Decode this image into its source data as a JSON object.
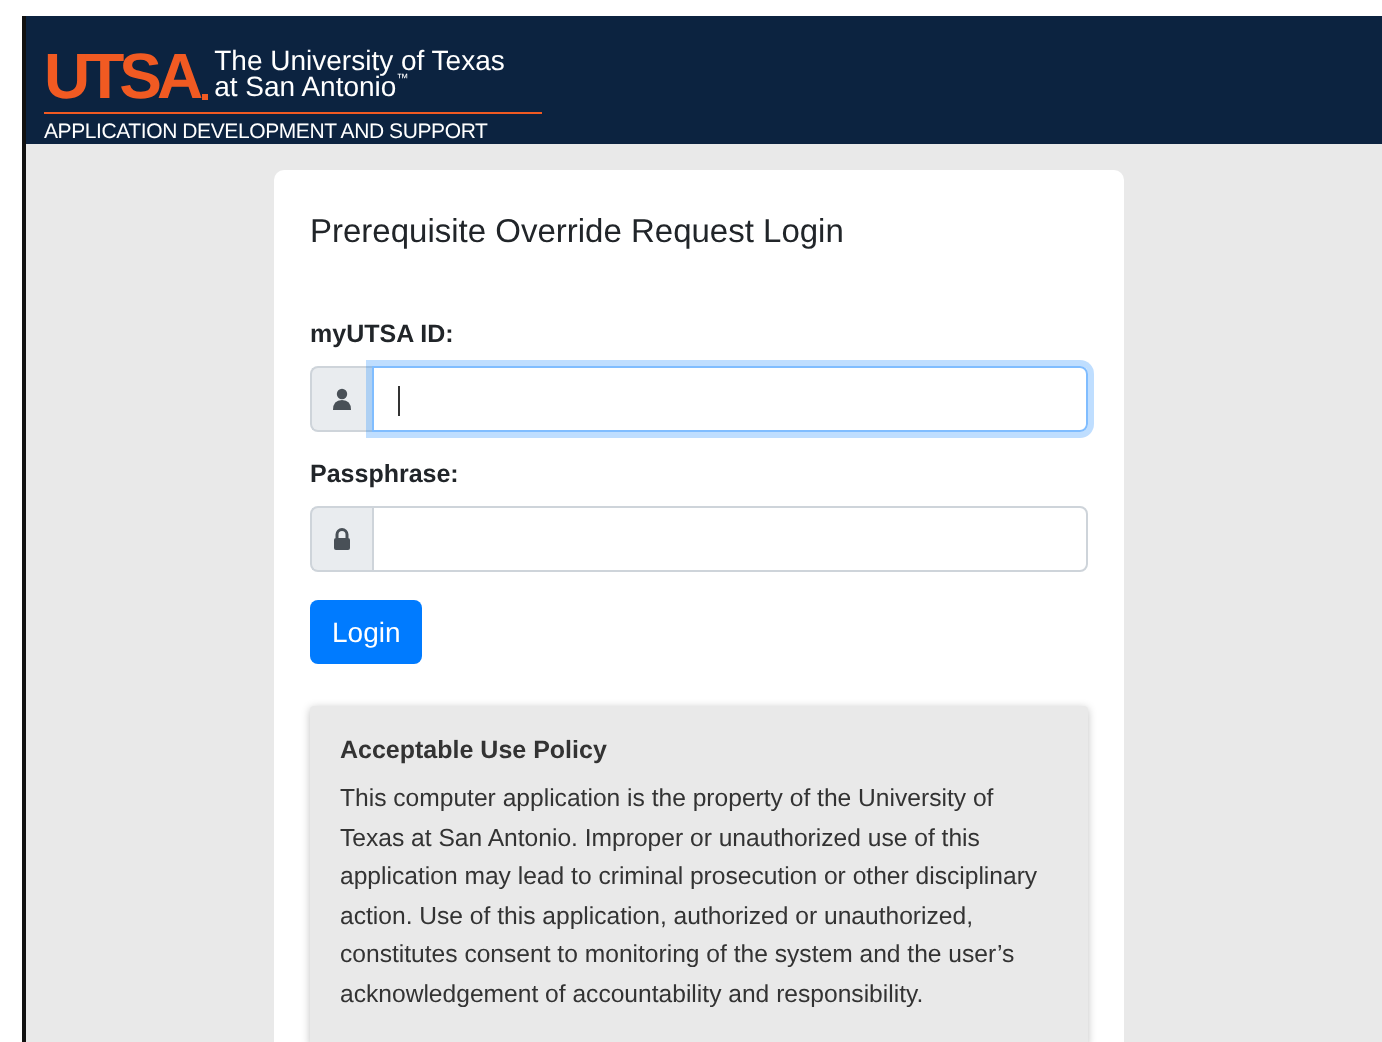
{
  "header": {
    "logo": "UTSA",
    "university_line_1": "The University of Texas",
    "university_line_2": "at San Antonio",
    "trademark": "™",
    "department": "APPLICATION DEVELOPMENT AND SUPPORT"
  },
  "login": {
    "title": "Prerequisite Override Request Login",
    "fields": [
      {
        "label": "myUTSA ID:",
        "kind": "user",
        "focused": true
      },
      {
        "label": "Passphrase:",
        "kind": "lock",
        "focused": false
      }
    ],
    "button": "Login"
  },
  "policy": {
    "title": "Acceptable Use Policy",
    "text": "This computer application is the property of the University of Texas at San Antonio. Improper or unauthorized use of this application may lead to criminal prosecution or other disciplinary action. Use of this application, authorized or unauthorized, constitutes consent to monitoring of the system and the user’s acknowledgement of accountability and responsibility."
  }
}
